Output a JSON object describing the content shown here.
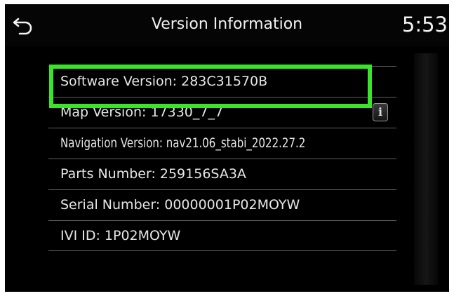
{
  "header": {
    "back_icon": "back-arrow-icon",
    "title": "Version Information",
    "clock": "5:53"
  },
  "info_rows": [
    {
      "label": "Software Version: 283C31570B"
    },
    {
      "label": "Map Version: 17330_7_7",
      "info_icon": "info-icon"
    },
    {
      "label": "Navigation Version: nav21.06_stabi_2022.27.2"
    },
    {
      "label": "Parts Number: 259156SA3A"
    },
    {
      "label": "Serial Number: 00000001P02MOYW"
    },
    {
      "label": "IVI ID: 1P02MOYW"
    }
  ],
  "info_icon_glyph": "i",
  "colors": {
    "screen_background": "#000000",
    "text": "#e6e6e6",
    "divider": "#5f5f5f",
    "highlight": "#39e42a"
  }
}
